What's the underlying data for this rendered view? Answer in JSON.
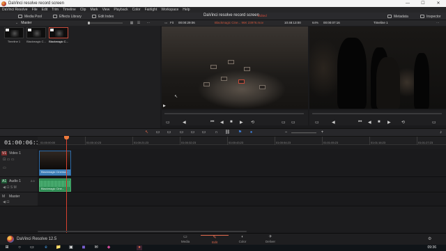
{
  "window": {
    "title": "DaVinci resolve record screen",
    "controls": [
      "—",
      "☐",
      "✕"
    ]
  },
  "menu": [
    "DaVinci Resolve",
    "File",
    "Edit",
    "Trim",
    "Timeline",
    "Clip",
    "Mark",
    "View",
    "Playback",
    "Color",
    "Fairlight",
    "Workspace",
    "Help"
  ],
  "toolbar": {
    "media_pool": "Media Pool",
    "effects_library": "Effects Library",
    "edit_index": "Edit Index",
    "project_title": "DaVinci resolve record screen",
    "project_tag": "Edited",
    "metadata": "Metadata",
    "inspector": "Inspector"
  },
  "media_pool": {
    "folder": "Master",
    "chevron": "⌄",
    "clips": [
      {
        "label": "Timeline 1",
        "selected": false
      },
      {
        "label": "Blackmagic C...",
        "selected": false
      },
      {
        "label": "Blackmagic C...",
        "selected": true
      }
    ]
  },
  "viewer": {
    "fit": "Fit",
    "source_tc": "00:00:29:06",
    "clip_name": "Blackmagic Cine... 96K 23976.mov",
    "source_time": "10:48:13:00",
    "zoom": "64%",
    "timeline_tc": "00:00:07:16",
    "timeline_name": "Timeline 1"
  },
  "transport": {
    "source_controls": [
      "⏮",
      "◀",
      "■",
      "▶",
      "⟲"
    ],
    "timeline_controls": [
      "⏮",
      "◀",
      "■",
      "▶",
      "⟲"
    ]
  },
  "timeline": {
    "timecode": "01:00:06:13",
    "ruler": [
      "01:00:00:00",
      "01:00:10:23",
      "01:00:21:23",
      "01:00:32:23",
      "01:00:43:23",
      "01:00:54:23",
      "01:01:05:23",
      "01:01:16:23",
      "01:01:27:23"
    ],
    "tracks": {
      "video": {
        "id": "V1",
        "name": "Video 1",
        "clip": "Blackmagic Cinema..."
      },
      "audio": {
        "id": "A1",
        "name": "Audio 1",
        "ch": "2.0",
        "clip": "Blackmagic Cine..."
      },
      "master": {
        "id": "M",
        "name": "Master"
      }
    }
  },
  "pages": [
    {
      "label": "Media",
      "icon": "▭",
      "active": false
    },
    {
      "label": "Edit",
      "icon": "✎",
      "active": true
    },
    {
      "label": "Color",
      "icon": "◐",
      "active": false
    },
    {
      "label": "Deliver",
      "icon": "✈",
      "active": false
    }
  ],
  "brand": "DaVinci Resolve 12.5",
  "taskbar": {
    "clock": "09:36",
    "apps": [
      "⊞",
      "○",
      "▭",
      "e",
      "📁",
      "▣",
      "◼",
      "✉",
      "◆",
      "●"
    ]
  },
  "colors": {
    "accent": "#e26a4d",
    "playhead": "#d9412f",
    "video_clip": "#3f7fb7",
    "audio_clip": "#2c8a52"
  }
}
